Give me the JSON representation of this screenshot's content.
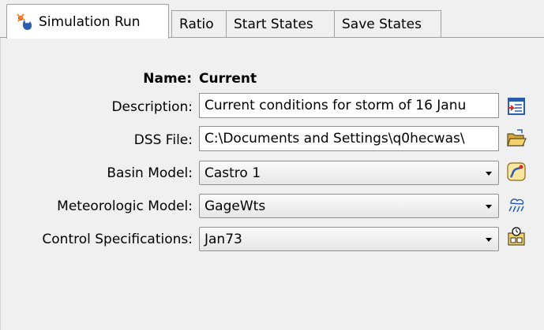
{
  "tabs": [
    {
      "label": "Simulation Run",
      "icon": "simulation-run-icon",
      "active": true
    },
    {
      "label": "Ratio",
      "active": false
    },
    {
      "label": "Start States",
      "active": false
    },
    {
      "label": "Save States",
      "active": false
    }
  ],
  "form": {
    "name_label": "Name:",
    "name_value": "Current",
    "description_label": "Description:",
    "description_value": "Current conditions for storm of 16 Janu",
    "dss_file_label": "DSS File:",
    "dss_file_value": "C:\\Documents and Settings\\q0hecwas\\",
    "basin_model_label": "Basin Model:",
    "basin_model_value": "Castro 1",
    "meteorologic_model_label": "Meteorologic Model:",
    "meteorologic_model_value": "GageWts",
    "control_spec_label": "Control Specifications:",
    "control_spec_value": "Jan73"
  },
  "buttons": {
    "description": "description-editor-icon",
    "dss_file": "open-folder-icon",
    "basin_model": "basin-model-icon",
    "meteorologic_model": "meteorologic-model-icon",
    "control_spec": "control-specifications-icon"
  },
  "colors": {
    "accent_red": "#d0302a",
    "accent_blue": "#2a5db0",
    "folder_yellow": "#e9c04a"
  }
}
